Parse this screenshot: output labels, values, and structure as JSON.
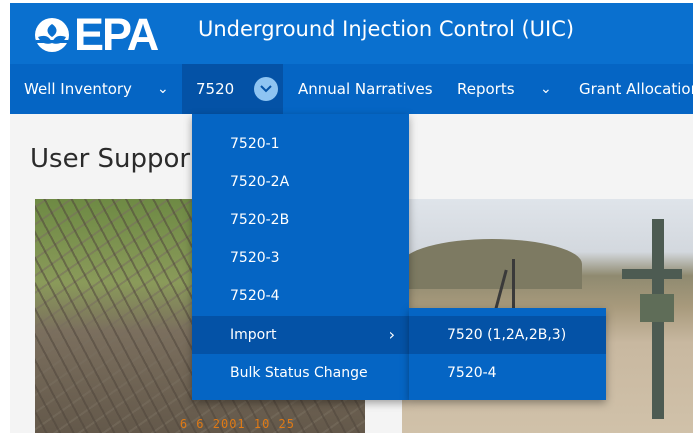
{
  "header": {
    "logo_text": "EPA",
    "app_title": "Underground Injection Control (UIC)"
  },
  "nav": {
    "items": [
      {
        "label": "Well Inventory",
        "has_dropdown": true
      },
      {
        "label": "7520",
        "has_dropdown": true,
        "active": true
      },
      {
        "label": "Annual Narratives",
        "has_dropdown": false
      },
      {
        "label": "Reports",
        "has_dropdown": true
      },
      {
        "label": "Grant Allocation",
        "has_dropdown": false
      }
    ]
  },
  "page": {
    "heading": "User Suppor",
    "photo_stamp": "6 6 2001 10 25"
  },
  "dropdown": {
    "items": [
      {
        "label": "7520-1"
      },
      {
        "label": "7520-2A"
      },
      {
        "label": "7520-2B"
      },
      {
        "label": "7520-3"
      },
      {
        "label": "7520-4"
      },
      {
        "label": "Import",
        "has_submenu": true
      },
      {
        "label": "Bulk Status Change"
      }
    ]
  },
  "submenu": {
    "items": [
      {
        "label": "7520 (1,2A,2B,3)"
      },
      {
        "label": "7520-4"
      }
    ]
  },
  "colors": {
    "header_bg": "#0a70cf",
    "nav_bg": "#0565c4",
    "active_bg": "#0452a6",
    "chevron_circle": "#8ec4f2"
  }
}
